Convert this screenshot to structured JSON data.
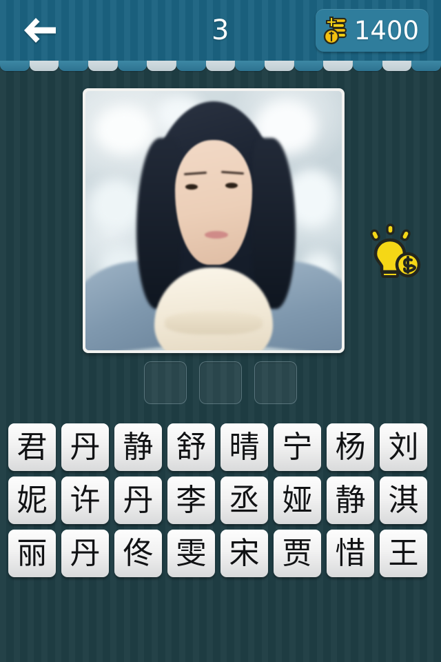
{
  "header": {
    "back_icon": "back-arrow-icon",
    "level_number": "3",
    "coin_icon": "coin-stack-plus-icon",
    "coin_count": "1400",
    "bar_color": "#1b6381",
    "badge_color": "#2f7d9c"
  },
  "background": {
    "color": "#1f3d44"
  },
  "scallop": {
    "tab_count": 15,
    "light_color": "#cbd7dc",
    "dark_color": "#34809d"
  },
  "puzzle": {
    "photo_alt": "portrait-photo-of-woman-in-white-scarf-and-denim-jacket",
    "hint_icon": "lightbulb-coin-hint-icon",
    "hint_bulb_color": "#f5d716",
    "answer_slots": [
      "",
      "",
      ""
    ],
    "answer_length": 3
  },
  "letter_grid": {
    "rows": [
      [
        "君",
        "丹",
        "静",
        "舒",
        "晴",
        "宁",
        "杨",
        "刘"
      ],
      [
        "妮",
        "许",
        "丹",
        "李",
        "丞",
        "娅",
        "静",
        "淇"
      ],
      [
        "丽",
        "丹",
        "佟",
        "雯",
        "宋",
        "贾",
        "惜",
        "王"
      ]
    ]
  }
}
